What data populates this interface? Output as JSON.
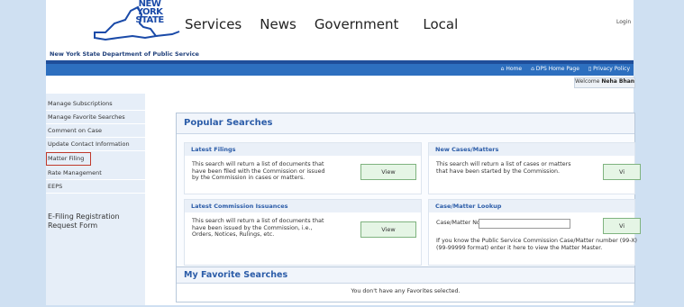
{
  "header": {
    "logo_text": [
      "NEW",
      "YORK",
      "STATE"
    ],
    "nav": [
      "Services",
      "News",
      "Government",
      "Local"
    ],
    "login_text": "Login"
  },
  "dept": {
    "name": "New York State Department of Public Service",
    "links": [
      "Home",
      "DPS Home Page",
      "Privacy Policy"
    ],
    "welcome_prefix": "Welcome",
    "welcome_name": "Neha Bhan"
  },
  "sidebar": {
    "items": [
      {
        "label": "Manage Subscriptions"
      },
      {
        "label": "Manage Favorite Searches"
      },
      {
        "label": "Comment on Case"
      },
      {
        "label": "Update Contact Information"
      },
      {
        "label": "Matter Filing"
      },
      {
        "label": "Rate Management"
      },
      {
        "label": "EEPS"
      }
    ],
    "registration": "E-Filing Registration Request Form"
  },
  "popular": {
    "title": "Popular Searches",
    "latest_filings": {
      "title": "Latest Filings",
      "text": "This search will return a list of documents that have been filed with the Commission or issued by the Commission in cases or matters.",
      "button": "View"
    },
    "new_cases": {
      "title": "New Cases/Matters",
      "text": "This search will return a list of cases or matters that have been started by the Commission.",
      "button": "Vi"
    },
    "latest_issuances": {
      "title": "Latest Commission Issuances",
      "text": "This search will return a list of documents that have been issued by the Commission, i.e., Orders, Notices, Rulings, etc.",
      "button": "View"
    },
    "case_lookup": {
      "title": "Case/Matter Lookup",
      "field_label": "Case/Matter No:",
      "field_value": "",
      "button": "Vi",
      "hint": "If you know the Public Service Commission Case/Matter number (99-X)(99-99999 format) enter it here to view the Matter Master."
    }
  },
  "favorites": {
    "title": "My Favorite Searches",
    "message": "You don't have any Favorites selected."
  }
}
